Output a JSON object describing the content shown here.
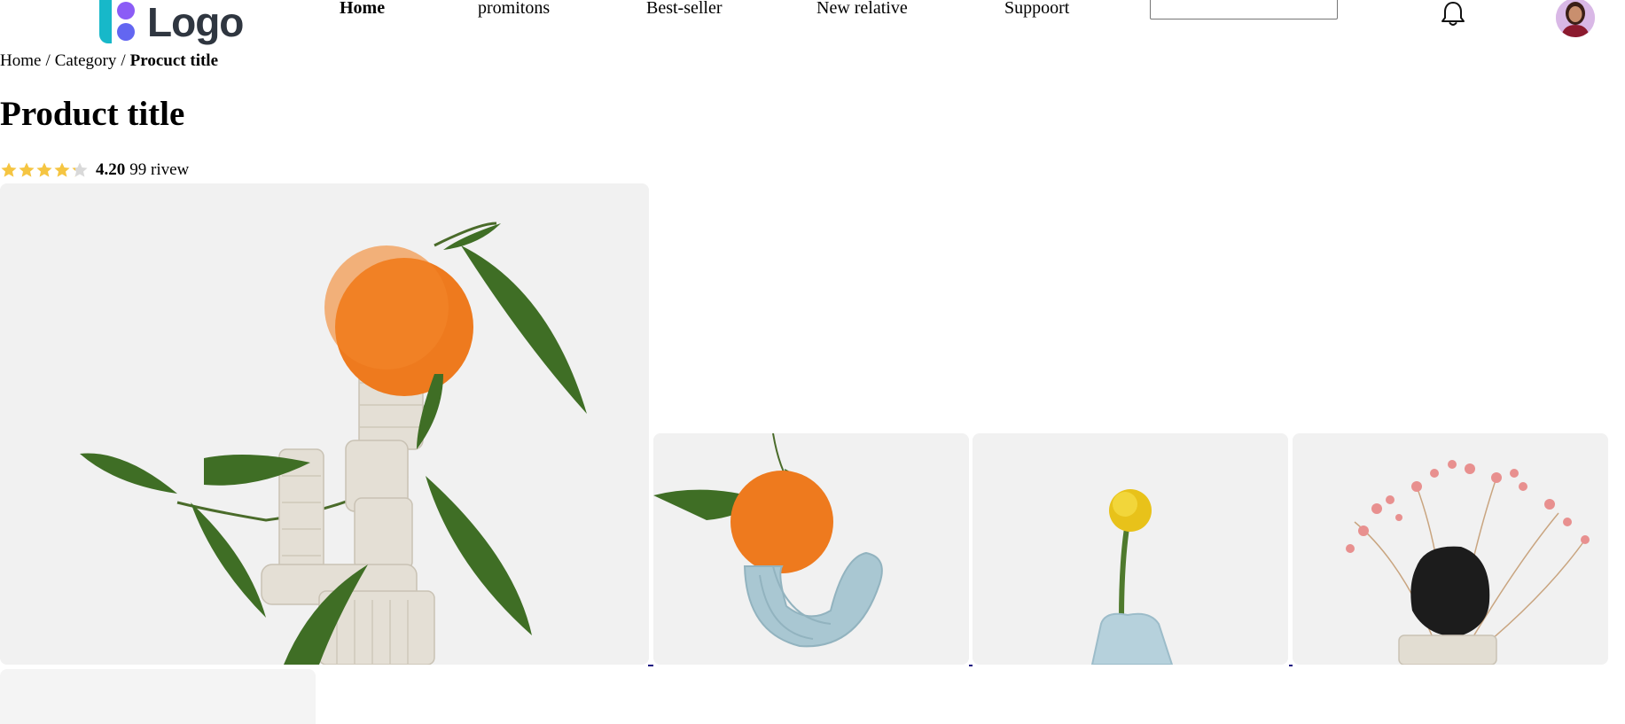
{
  "header": {
    "logo_text": "Logo",
    "nav": [
      {
        "label": "Home",
        "active": true
      },
      {
        "label": "promitons",
        "active": false
      },
      {
        "label": "Best-seller",
        "active": false
      },
      {
        "label": "New relative",
        "active": false
      },
      {
        "label": "Suppoort",
        "active": false
      }
    ],
    "search": {
      "value": "",
      "placeholder": ""
    },
    "notification_icon": "bell-icon",
    "avatar_icon": "user-avatar"
  },
  "breadcrumb": {
    "items": [
      "Home",
      "Category"
    ],
    "separator": "/",
    "current": "Procuct title"
  },
  "product": {
    "title": "Product title",
    "rating": {
      "stars": 4.2,
      "max": 5,
      "value": "4.20",
      "reviews": "99 rivew"
    }
  },
  "gallery": {
    "main": "orange-on-clay-sculpture",
    "thumbnails": [
      "orange-on-blue-clay",
      "yellow-flower-in-vase",
      "pink-dried-flowers-with-black-rock"
    ]
  },
  "colors": {
    "star": "#f5c542",
    "star_empty": "#d9d9d9",
    "logo_teal": "#17b8c9",
    "logo_purple": "#8b5cf6",
    "logo_indigo": "#6366f1",
    "thumb_underline": "#1a0a80"
  }
}
